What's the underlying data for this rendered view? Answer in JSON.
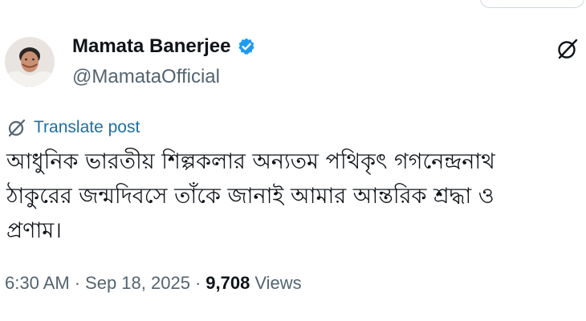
{
  "author": {
    "display_name": "Mamata Banerjee",
    "handle": "@MamataOfficial"
  },
  "translate": {
    "label": "Translate post"
  },
  "tweet": {
    "lines": [
      "আধুনিক ভারতীয় শিল্পকলার অন্যতম পথিকৃৎ গগনেন্দ্রনাথ",
      "ঠাকুরের জন্মদিবসে তাঁকে জানাই আমার আন্তরিক শ্রদ্ধা ও",
      "প্রণাম।"
    ]
  },
  "meta": {
    "time": "6:30 AM",
    "separator": "·",
    "date": "Sep 18, 2025",
    "views_count": "9,708",
    "views_label": "Views"
  },
  "colors": {
    "accent": "#1d9bf0",
    "link": "#1d6fa3",
    "secondary_text": "#536471",
    "primary_text": "#0f1419"
  }
}
